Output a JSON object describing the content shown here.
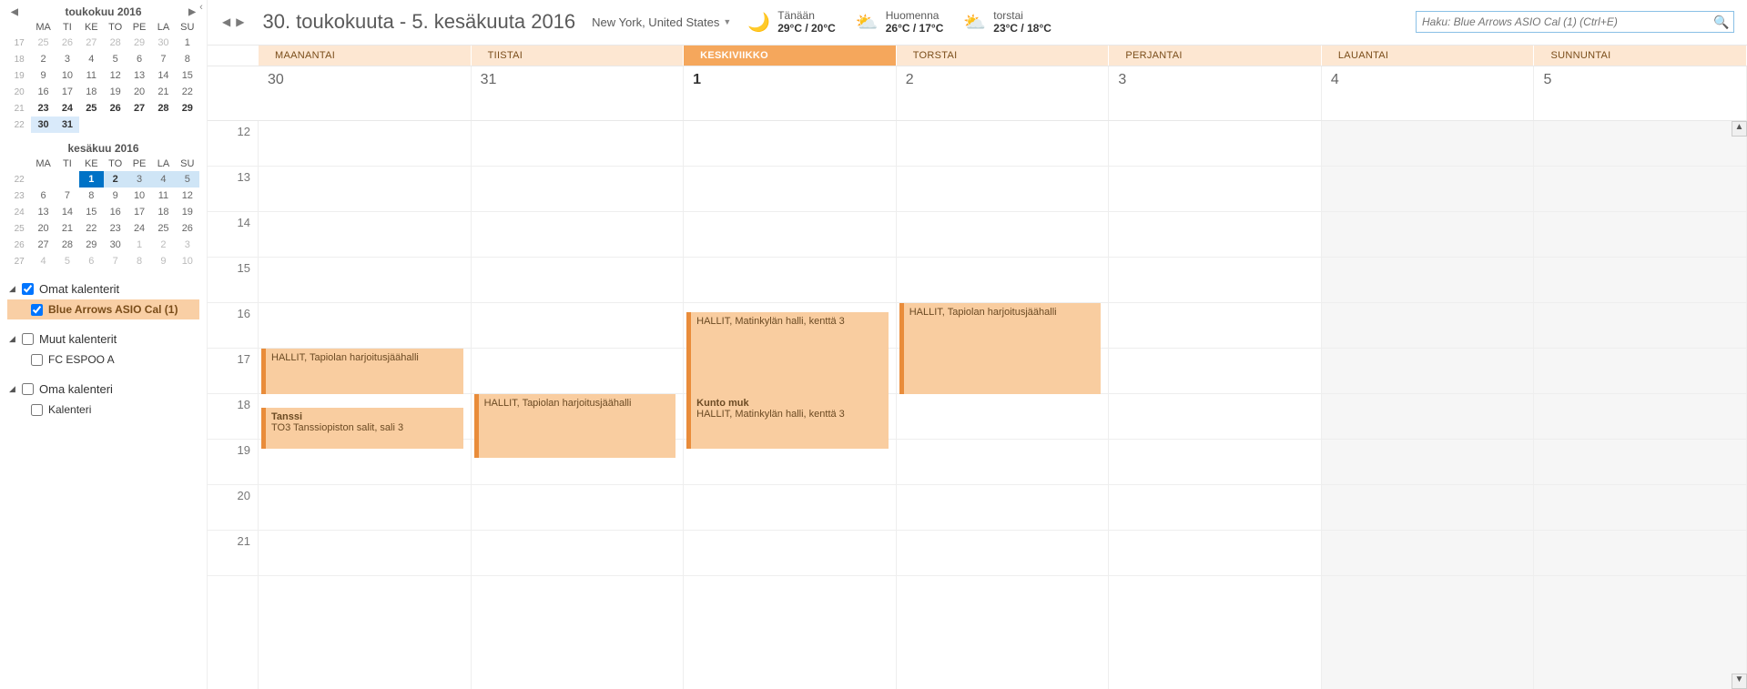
{
  "sidebar": {
    "month1": {
      "title": "toukokuu 2016",
      "dow": [
        "MA",
        "TI",
        "KE",
        "TO",
        "PE",
        "LA",
        "SU"
      ],
      "rows": [
        {
          "wk": "17",
          "d": [
            "25",
            "26",
            "27",
            "28",
            "29",
            "30",
            "1"
          ],
          "dim": [
            0,
            1,
            2,
            3,
            4,
            5
          ]
        },
        {
          "wk": "18",
          "d": [
            "2",
            "3",
            "4",
            "5",
            "6",
            "7",
            "8"
          ]
        },
        {
          "wk": "19",
          "d": [
            "9",
            "10",
            "11",
            "12",
            "13",
            "14",
            "15"
          ]
        },
        {
          "wk": "20",
          "d": [
            "16",
            "17",
            "18",
            "19",
            "20",
            "21",
            "22"
          ]
        },
        {
          "wk": "21",
          "d": [
            "23",
            "24",
            "25",
            "26",
            "27",
            "28",
            "29"
          ],
          "bold": [
            0,
            1,
            2,
            3,
            4,
            5,
            6
          ]
        },
        {
          "wk": "22",
          "d": [
            "30",
            "31",
            "",
            "",
            "",
            "",
            ""
          ],
          "hl": [
            0,
            1
          ]
        }
      ]
    },
    "month2": {
      "title": "kesäkuu 2016",
      "dow": [
        "MA",
        "TI",
        "KE",
        "TO",
        "PE",
        "LA",
        "SU"
      ],
      "rows": [
        {
          "wk": "22",
          "d": [
            "",
            "",
            "1",
            "2",
            "3",
            "4",
            "5"
          ],
          "today": 2,
          "sel": [
            2,
            3,
            4,
            5,
            6
          ],
          "bold": [
            3
          ]
        },
        {
          "wk": "23",
          "d": [
            "6",
            "7",
            "8",
            "9",
            "10",
            "11",
            "12"
          ]
        },
        {
          "wk": "24",
          "d": [
            "13",
            "14",
            "15",
            "16",
            "17",
            "18",
            "19"
          ]
        },
        {
          "wk": "25",
          "d": [
            "20",
            "21",
            "22",
            "23",
            "24",
            "25",
            "26"
          ]
        },
        {
          "wk": "26",
          "d": [
            "27",
            "28",
            "29",
            "30",
            "1",
            "2",
            "3"
          ],
          "dim": [
            4,
            5,
            6
          ]
        },
        {
          "wk": "27",
          "d": [
            "4",
            "5",
            "6",
            "7",
            "8",
            "9",
            "10"
          ],
          "dim": [
            0,
            1,
            2,
            3,
            4,
            5,
            6
          ]
        }
      ]
    },
    "groups": [
      {
        "label": "Omat kalenterit",
        "checked": true,
        "items": [
          {
            "label": "Blue Arrows ASIO Cal (1)",
            "checked": true,
            "selected": true
          }
        ]
      },
      {
        "label": "Muut kalenterit",
        "checked": false,
        "items": [
          {
            "label": "FC ESPOO A",
            "checked": false
          }
        ]
      },
      {
        "label": "Oma kalenteri",
        "checked": false,
        "items": [
          {
            "label": "Kalenteri",
            "checked": false
          }
        ]
      }
    ]
  },
  "header": {
    "range": "30. toukokuuta - 5. kesäkuuta 2016",
    "location": "New York, United States",
    "weather": [
      {
        "icon": "🌙",
        "day": "Tänään",
        "temp": "29°C / 20°C"
      },
      {
        "icon": "⛅",
        "day": "Huomenna",
        "temp": "26°C / 17°C"
      },
      {
        "icon": "⛅",
        "day": "torstai",
        "temp": "23°C / 18°C"
      }
    ],
    "search_placeholder": "Haku: Blue Arrows ASIO Cal (1) (Ctrl+E)"
  },
  "days": {
    "names": [
      "MAANANTAI",
      "TIISTAI",
      "KESKIVIIKKO",
      "TORSTAI",
      "PERJANTAI",
      "LAUANTAI",
      "SUNNUNTAI"
    ],
    "dates": [
      "30",
      "31",
      "1",
      "2",
      "3",
      "4",
      "5"
    ],
    "today_index": 2,
    "weekend": [
      5,
      6
    ]
  },
  "hours": [
    "12",
    "13",
    "14",
    "15",
    "16",
    "17",
    "18",
    "19",
    "20",
    "21"
  ],
  "events": [
    {
      "day": 0,
      "start": 17,
      "end": 18,
      "title": "",
      "loc": "HALLIT, Tapiolan harjoitusjäähalli"
    },
    {
      "day": 0,
      "start": 18.3,
      "end": 19.2,
      "title": "Tanssi",
      "loc": "TO3 Tanssiopiston salit, sali 3"
    },
    {
      "day": 1,
      "start": 18,
      "end": 19.4,
      "title": "",
      "loc": "HALLIT, Tapiolan harjoitusjäähalli"
    },
    {
      "day": 2,
      "start": 16.2,
      "end": 18,
      "title": "",
      "loc": "HALLIT, Matinkylän halli, kenttä 3"
    },
    {
      "day": 2,
      "start": 18,
      "end": 19.2,
      "title": "Kunto muk",
      "loc": "HALLIT, Matinkylän halli, kenttä 3"
    },
    {
      "day": 3,
      "start": 16,
      "end": 18,
      "title": "",
      "loc": "HALLIT, Tapiolan harjoitusjäähalli"
    }
  ]
}
